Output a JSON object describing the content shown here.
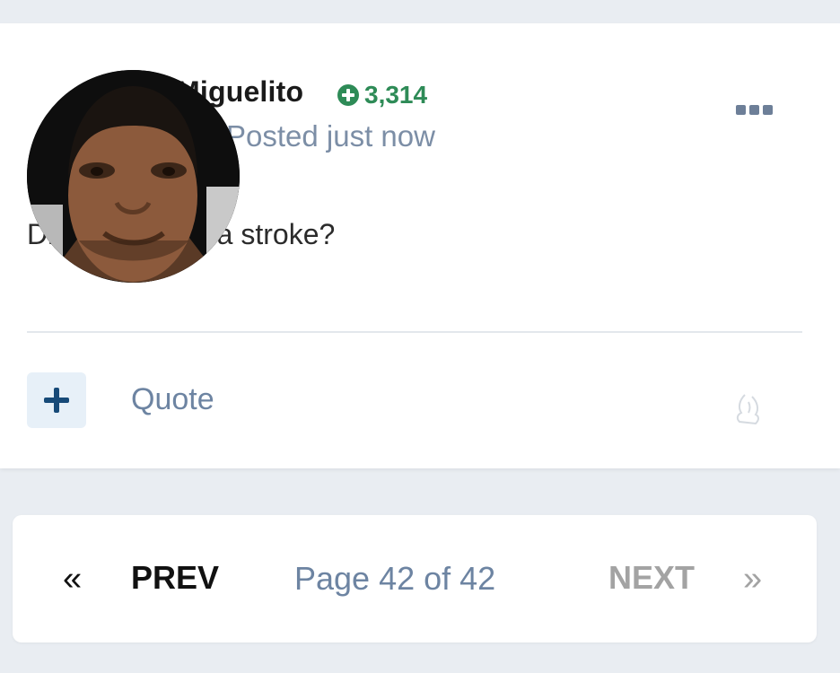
{
  "post": {
    "author": "Miguelito",
    "reputation": "3,314",
    "time": "Posted just now",
    "body": "Did I just have a stroke?",
    "actions": {
      "quote_label": "Quote"
    },
    "icons": {
      "reputation": "plus-circle-icon",
      "menu": "more-options-icon",
      "add": "plus-icon",
      "react": "reaction-icon"
    }
  },
  "pagination": {
    "first_glyph": "«",
    "prev_label": "PREV",
    "page_text": "Page 42 of 42",
    "next_label": "NEXT",
    "last_glyph": "»"
  },
  "colors": {
    "reputation": "#2e8b57",
    "muted": "#6d84a2",
    "add_button_bg": "#e7f0f8",
    "add_button_fg": "#174a78",
    "disabled": "#a3a3a3"
  }
}
